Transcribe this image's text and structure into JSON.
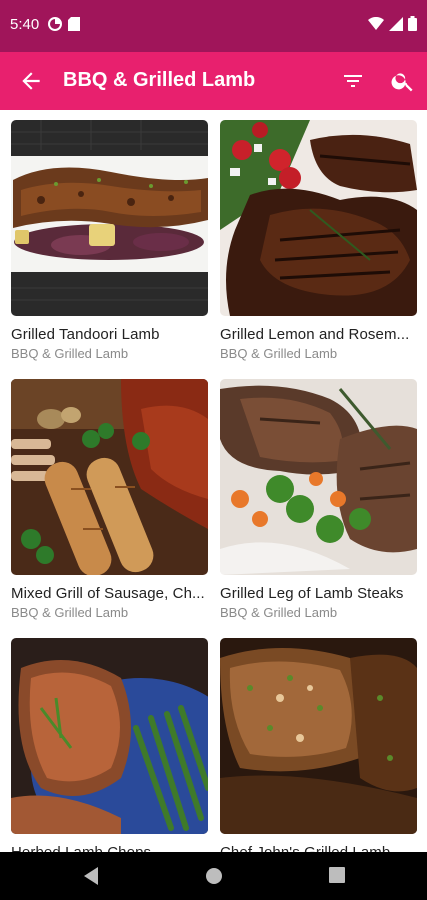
{
  "status": {
    "time": "5:40"
  },
  "appbar": {
    "title": "BBQ & Grilled Lamb",
    "back_icon": "arrow-back-icon",
    "filter_icon": "filter-icon",
    "search_icon": "search-icon"
  },
  "colors": {
    "status_bar": "#a0155a",
    "app_bar": "#e8206e"
  },
  "recipes": [
    {
      "title": "Grilled Tandoori Lamb",
      "category": "BBQ & Grilled Lamb"
    },
    {
      "title": "Grilled Lemon and Rosem...",
      "category": "BBQ & Grilled Lamb"
    },
    {
      "title": "Mixed Grill of Sausage, Ch...",
      "category": "BBQ & Grilled Lamb"
    },
    {
      "title": "Grilled Leg of Lamb Steaks",
      "category": "BBQ & Grilled Lamb"
    },
    {
      "title": "Herbed Lamb Chops",
      "category": ""
    },
    {
      "title": "Chef John's Grilled Lamb",
      "category": ""
    }
  ]
}
